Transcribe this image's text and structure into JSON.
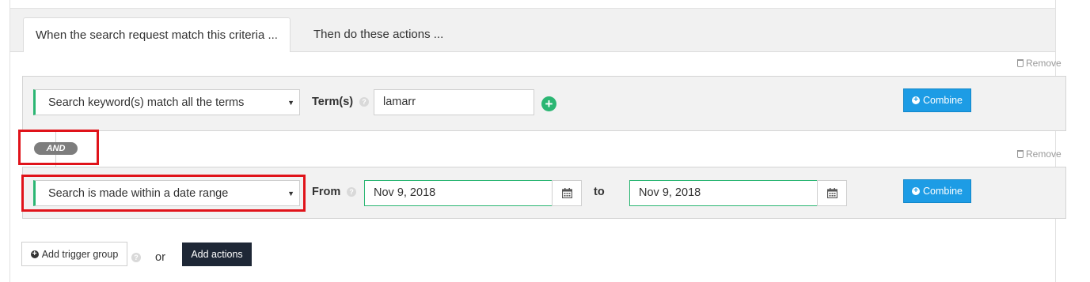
{
  "tabs": [
    {
      "label": "When the search request match this criteria ..."
    },
    {
      "label": "Then do these actions ..."
    }
  ],
  "remove_label": "Remove",
  "rule1": {
    "select_value": "Search keyword(s) match all the terms",
    "field_label": "Term(s)",
    "term_value": "lamarr",
    "combine_label": "Combine"
  },
  "and_label": "AND",
  "rule2": {
    "select_value": "Search is made within a date range",
    "from_label": "From",
    "from_value": "Nov 9, 2018",
    "to_label": "to",
    "to_value": "Nov 9, 2018",
    "combine_label": "Combine"
  },
  "footer": {
    "add_trigger_group": "Add trigger group",
    "or_label": "or",
    "add_actions": "Add actions"
  },
  "colors": {
    "accent_green": "#2bb673",
    "combine_blue": "#1d9ce5",
    "highlight_red": "#e0131a",
    "dark_button": "#1e2736"
  }
}
